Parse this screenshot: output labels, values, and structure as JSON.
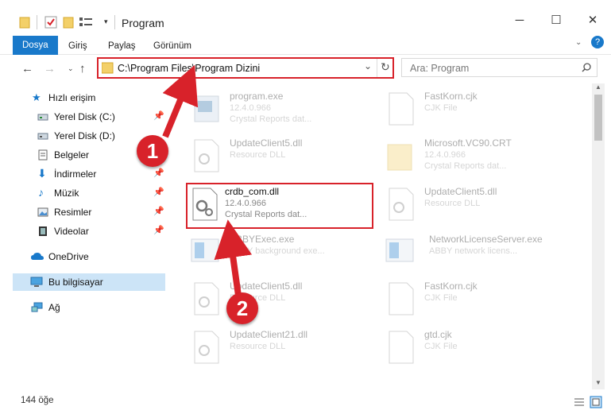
{
  "window": {
    "title": "Program",
    "controls": {
      "minimize": "─",
      "maximize": "☐",
      "close": "✕"
    }
  },
  "ribbon": {
    "tabs": [
      "Dosya",
      "Giriş",
      "Paylaş",
      "Görünüm"
    ],
    "help": "?"
  },
  "navigation": {
    "address": "C:\\Program Files\\Program Dizini",
    "search_placeholder": "Ara: Program"
  },
  "sidebar": {
    "items": [
      {
        "label": "Hızlı erişim",
        "icon": "star-icon"
      },
      {
        "label": "Yerel Disk (C:)",
        "icon": "drive-icon",
        "pinned": true
      },
      {
        "label": "Yerel Disk (D:)",
        "icon": "drive-icon"
      },
      {
        "label": "Belgeler",
        "icon": "documents-icon"
      },
      {
        "label": "İndirmeler",
        "icon": "download-icon",
        "pinned": true
      },
      {
        "label": "Müzik",
        "icon": "music-icon",
        "pinned": true
      },
      {
        "label": "Resimler",
        "icon": "pictures-icon",
        "pinned": true
      },
      {
        "label": "Videolar",
        "icon": "video-icon",
        "pinned": true
      },
      {
        "label": "OneDrive",
        "icon": "cloud-icon"
      },
      {
        "label": "Bu bilgisayar",
        "icon": "computer-icon",
        "selected": true
      },
      {
        "label": "Ağ",
        "icon": "network-icon"
      }
    ]
  },
  "files": [
    {
      "name": "program.exe",
      "version": "12.4.0.966",
      "desc": "Crystal Reports dat..."
    },
    {
      "name": "FastKorn.cjk",
      "version": "CJK File",
      "desc": ""
    },
    {
      "name": "UpdateClient5.dll",
      "version": "Resource DLL",
      "desc": ""
    },
    {
      "name": "Microsoft.VC90.CRT",
      "version": "12.4.0.966",
      "desc": "Crystal Reports dat..."
    },
    {
      "name": "crdb_com.dll",
      "version": "12.4.0.966",
      "desc": "Crystal Reports dat..."
    },
    {
      "name": "UpdateClient5.dll",
      "version": "Resource DLL",
      "desc": ""
    },
    {
      "name": "ABBYExec.exe",
      "version": "ABBY background exe...",
      "desc": ""
    },
    {
      "name": "NetworkLicenseServer.exe",
      "version": "ABBY network licens...",
      "desc": ""
    },
    {
      "name": "UpdateClient5.dll",
      "version": "Resource DLL",
      "desc": ""
    },
    {
      "name": "FastKorn.cjk",
      "version": "CJK File",
      "desc": ""
    },
    {
      "name": "UpdateClient21.dll",
      "version": "Resource DLL",
      "desc": ""
    },
    {
      "name": "gtd.cjk",
      "version": "CJK File",
      "desc": ""
    }
  ],
  "status": {
    "count": "144 öğe"
  },
  "annotations": {
    "badge1": "1",
    "badge2": "2"
  },
  "colors": {
    "accent": "#1979ca",
    "highlight": "#d8222a",
    "selection": "#cce4f7"
  }
}
